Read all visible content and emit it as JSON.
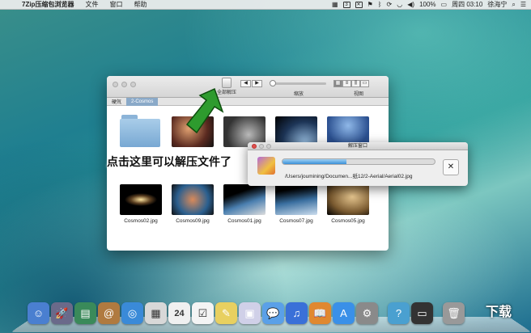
{
  "menubar": {
    "apple": "",
    "app": "7Zip压缩包浏览器",
    "items": [
      "文件",
      "窗口",
      "帮助"
    ],
    "status": "3",
    "battery": "100%",
    "time": "周四 03:10",
    "user": "徐海宁"
  },
  "finder": {
    "toolbar": {
      "extract_label": "全部解压",
      "zoom_label": "缩放",
      "view_label": "视图"
    },
    "crumbs": [
      "硬氘",
      "2-Cosmos"
    ],
    "top_icons": [
      "",
      "",
      "",
      "",
      ""
    ],
    "bottom_icons": [
      {
        "name": "Cosmos02.jpg"
      },
      {
        "name": "Cosmos09.jpg"
      },
      {
        "name": "Cosmos01.jpg"
      },
      {
        "name": "Cosmos07.jpg"
      },
      {
        "name": "Cosmos05.jpg"
      }
    ]
  },
  "overlay_text": "点击这里可以解压文件了",
  "dialog": {
    "title": "解压窗口",
    "path": "/Users/joumining/Documen...纸12/2-Aerial/Aerial02.jpg",
    "progress": 0.42,
    "cancel": "✕"
  },
  "dock": {
    "icons": [
      "finder-icon",
      "launchpad-icon",
      "mission-control-icon",
      "contacts-icon",
      "safari-icon",
      "photo-icon",
      "calendar-icon",
      "reminders-icon",
      "notes-icon",
      "preview-icon",
      "messages-icon",
      "itunes-icon",
      "ibooks-icon",
      "app-store-icon",
      "system-prefs-icon",
      "help-icon",
      "terminal-icon",
      "trash-icon"
    ],
    "calendar_day": "24"
  },
  "watermark": "下载"
}
